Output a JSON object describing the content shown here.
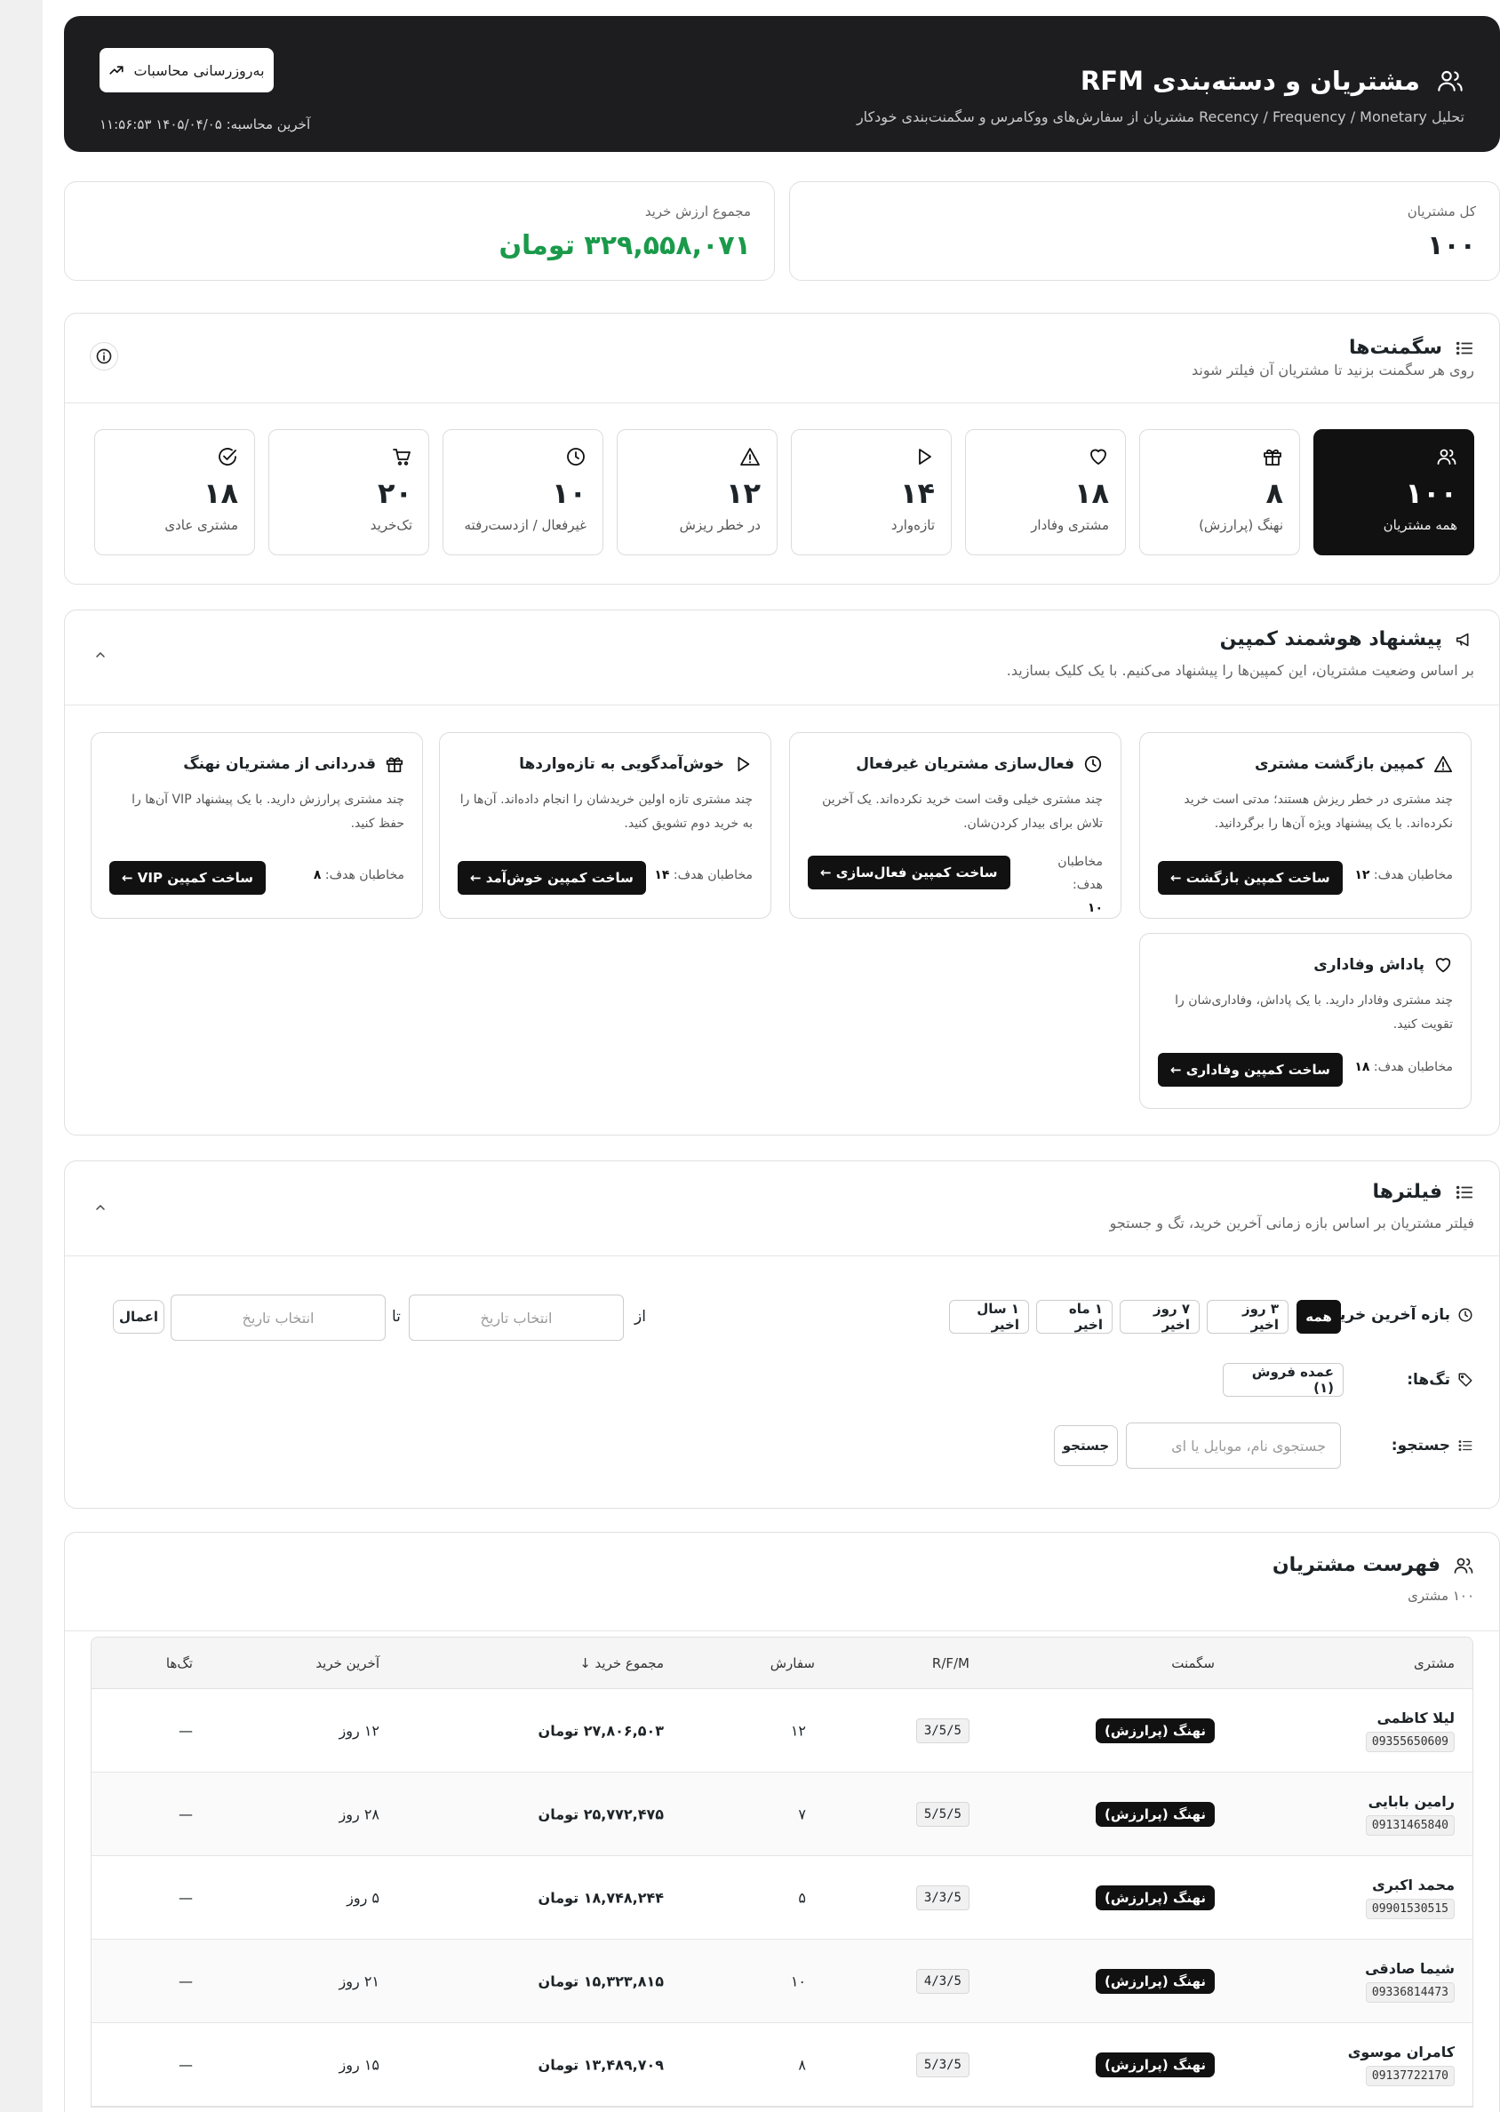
{
  "header": {
    "title": "مشتریان و دسته‌بندی RFM",
    "subtitle": "تحلیل Recency / Frequency / Monetary مشتریان از سفارش‌های ووکامرس و سگمنت‌بندی خودکار",
    "refresh_label": "به‌روزرسانی محاسبات",
    "last_calc": "آخرین محاسبه: ۱۴۰۵/۰۴/۰۵ ۱۱:۵۶:۵۳"
  },
  "stats": {
    "total_customers_label": "کل مشتریان",
    "total_customers_value": "۱۰۰",
    "total_value_label": "مجموع ارزش خرید",
    "total_value_value": "۳۲۹,۵۵۸,۰۷۱ تومان"
  },
  "segments": {
    "title": "سگمنت‌ها",
    "subtitle": "روی هر سگمنت بزنید تا مشتریان آن فیلتر شوند",
    "items": [
      {
        "label": "همه مشتریان",
        "count": "۱۰۰",
        "icon": "users-icon"
      },
      {
        "label": "نهنگ (پرارزش)",
        "count": "۸",
        "icon": "gift-icon"
      },
      {
        "label": "مشتری وفادار",
        "count": "۱۸",
        "icon": "heart-icon"
      },
      {
        "label": "تازه‌وارد",
        "count": "۱۴",
        "icon": "play-icon"
      },
      {
        "label": "در خطر ریزش",
        "count": "۱۲",
        "icon": "warning-icon"
      },
      {
        "label": "غیرفعال / ازدست‌رفته",
        "count": "۱۰",
        "icon": "clock-icon"
      },
      {
        "label": "تک‌خرید",
        "count": "۲۰",
        "icon": "cart-icon"
      },
      {
        "label": "مشتری عادی",
        "count": "۱۸",
        "icon": "check-circle-icon"
      }
    ]
  },
  "campaigns": {
    "title": "پیشنهاد هوشمند کمپین",
    "subtitle": "بر اساس وضعیت مشتریان، این کمپین‌ها را پیشنهاد می‌کنیم. با یک کلیک بسازید.",
    "audience_label": "مخاطبان هدف:",
    "items": [
      {
        "title": "کمپین بازگشت مشتری",
        "desc": "چند مشتری در خطر ریزش هستند؛ مدتی است خرید نکرده‌اند. با یک پیشنهاد ویژه آن‌ها را برگردانید.",
        "audience": "۱۲",
        "button": "ساخت کمپین بازگشت ←",
        "icon": "warning-icon"
      },
      {
        "title": "فعال‌سازی مشتریان غیرفعال",
        "desc": "چند مشتری خیلی وقت است خرید نکرده‌اند. یک آخرین تلاش برای بیدار کردن‌شان.",
        "audience": "۱۰",
        "button": "ساخت کمپین فعال‌سازی ←",
        "icon": "clock-icon"
      },
      {
        "title": "خوش‌آمدگویی به تازه‌واردها",
        "desc": "چند مشتری تازه اولین خریدشان را انجام داده‌اند. آن‌ها را به خرید دوم تشویق کنید.",
        "audience": "۱۴",
        "button": "ساخت کمپین خوش‌آمد ←",
        "icon": "play-icon"
      },
      {
        "title": "قدردانی از مشتریان نهنگ",
        "desc": "چند مشتری پرارزش دارید. با یک پیشنهاد VIP آن‌ها را حفظ کنید.",
        "audience": "۸",
        "button": "ساخت کمپین VIP ←",
        "icon": "gift-icon"
      },
      {
        "title": "پاداش وفاداری",
        "desc": "چند مشتری وفادار دارید. با یک پاداش، وفاداری‌شان را تقویت کنید.",
        "audience": "۱۸",
        "button": "ساخت کمپین وفاداری ←",
        "icon": "heart-icon"
      }
    ]
  },
  "filters": {
    "title": "فیلترها",
    "subtitle": "فیلتر مشتریان بر اساس بازه زمانی آخرین خرید، تگ و جستجو",
    "range_label": "بازه آخرین خرید:",
    "range_options": [
      "همه",
      "۳ روز اخیر",
      "۷ روز اخیر",
      "۱ ماه اخیر",
      "۱ سال اخیر"
    ],
    "range_selected": "همه",
    "from_label": "از",
    "to_label": "تا",
    "date_placeholder": "انتخاب تاریخ",
    "apply_label": "اعمال",
    "tags_label": "تگ‌ها:",
    "tags": [
      "عمده فروش (۱)"
    ],
    "search_label": "جستجو:",
    "search_placeholder": "جستجوی نام، موبایل یا ای",
    "search_button": "جستجو"
  },
  "customers": {
    "title": "فهرست مشتریان",
    "count": "۱۰۰ مشتری",
    "columns": {
      "customer": "مشتری",
      "segment": "سگمنت",
      "rfm": "R/F/M",
      "orders": "سفارش",
      "total": "مجموع خرید ↓",
      "last": "آخرین خرید",
      "tags": "تگ‌ها"
    },
    "rows": [
      {
        "name": "لیلا کاظمی",
        "phone": "09355650609",
        "segment": "نهنگ (پرارزش)",
        "rfm": "3/5/5",
        "orders": "۱۲",
        "total": "۲۷,۸۰۶,۵۰۳ تومان",
        "last": "۱۲ روز",
        "tags": "—"
      },
      {
        "name": "رامین بابایی",
        "phone": "09131465840",
        "segment": "نهنگ (پرارزش)",
        "rfm": "5/5/5",
        "orders": "۷",
        "total": "۲۵,۷۷۲,۴۷۵ تومان",
        "last": "۲۸ روز",
        "tags": "—"
      },
      {
        "name": "محمد اکبری",
        "phone": "09901530515",
        "segment": "نهنگ (پرارزش)",
        "rfm": "3/3/5",
        "orders": "۵",
        "total": "۱۸,۷۴۸,۲۴۴ تومان",
        "last": "۵ روز",
        "tags": "—"
      },
      {
        "name": "شیما صادقی",
        "phone": "09336814473",
        "segment": "نهنگ (پرارزش)",
        "rfm": "4/3/5",
        "orders": "۱۰",
        "total": "۱۵,۳۲۳,۸۱۵ تومان",
        "last": "۲۱ روز",
        "tags": "—"
      },
      {
        "name": "کامران موسوی",
        "phone": "09137722170",
        "segment": "نهنگ (پرارزش)",
        "rfm": "5/3/5",
        "orders": "۸",
        "total": "۱۳,۴۸۹,۷۰۹ تومان",
        "last": "۱۵ روز",
        "tags": "—"
      }
    ]
  },
  "colors": {
    "accent": "#111111",
    "money": "#1a9a4a"
  }
}
